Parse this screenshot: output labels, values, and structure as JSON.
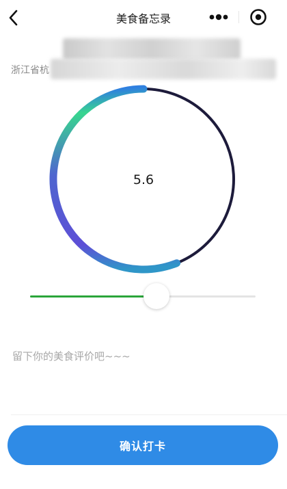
{
  "nav": {
    "title": "美食备忘录",
    "back_icon": "chevron-left-icon",
    "more_icon": "more-dots-icon",
    "close_icon": "target-circle-icon"
  },
  "location": {
    "text": "浙江省杭"
  },
  "rating": {
    "value": "5.6",
    "fraction": 0.56,
    "ring_track_color": "#1d1b3b",
    "ring_gradient_colors": [
      "#2f7fe0",
      "#38d58f",
      "#5156d0",
      "#5d4fd6",
      "#2f96c8"
    ]
  },
  "slider": {
    "fraction": 0.56,
    "fill_color": "#2aa53a",
    "track_color": "#e4e4e4"
  },
  "comment": {
    "placeholder": "留下你的美食评价吧~~~"
  },
  "confirm": {
    "label": "确认打卡",
    "color": "#2f8be6"
  }
}
